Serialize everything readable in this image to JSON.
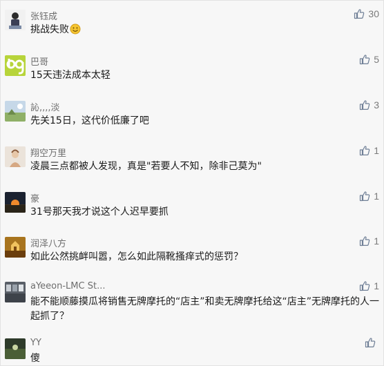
{
  "comments": [
    {
      "name": "张钰成",
      "text": "挑战失败",
      "likes": "30",
      "emoji": "smile-emoji"
    },
    {
      "name": "巴哥",
      "text": "15天违法成本太轻",
      "likes": "5"
    },
    {
      "name": "訫,,,,淡",
      "text": "先关15日，这代价低廉了吧",
      "likes": "3"
    },
    {
      "name": "翔空万里",
      "text": "凌晨三点都被人发现，真是\"若要人不知，除非己莫为\"",
      "likes": "1"
    },
    {
      "name": "豪",
      "text": "31号那天我才说这个人迟早要抓",
      "likes": "1"
    },
    {
      "name": "润泽八方",
      "text": "如此公然挑衅叫嚣，怎么如此隔靴搔痒式的惩罚？",
      "likes": "1"
    },
    {
      "name": "aYeeon-LMC St...",
      "text": "能不能顺藤摸瓜将销售无牌摩托的“店主”和卖无牌摩托给这“店主”无牌摩托的人一起抓了？",
      "likes": "1"
    },
    {
      "name": "YY",
      "text": "傻",
      "likes": ""
    }
  ],
  "icons": {
    "like": "thumbs-up-icon",
    "colors": {
      "like": "#6f7f96",
      "name": "#6d6d6d",
      "text": "#1a1a1a"
    }
  }
}
